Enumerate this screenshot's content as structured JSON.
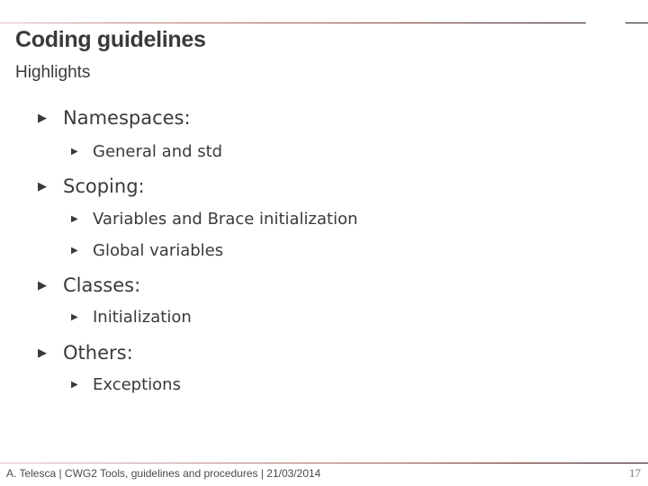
{
  "slide": {
    "title": "Coding guidelines",
    "subtitle": "Highlights"
  },
  "bullets": [
    {
      "label": "Namespaces:",
      "icon": "triangle-bullet-icon",
      "children": [
        {
          "label": "General and std",
          "icon": "triangle-bullet-icon"
        }
      ]
    },
    {
      "label": "Scoping:",
      "icon": "triangle-bullet-icon",
      "children": [
        {
          "label": "Variables and Brace initialization",
          "icon": "triangle-bullet-icon"
        },
        {
          "label": "Global variables",
          "icon": "triangle-bullet-icon"
        }
      ]
    },
    {
      "label": "Classes:",
      "icon": "triangle-bullet-icon",
      "children": [
        {
          "label": "Initialization",
          "icon": "triangle-bullet-icon"
        }
      ]
    },
    {
      "label": "Others:",
      "icon": "triangle-bullet-icon",
      "children": [
        {
          "label": "Exceptions",
          "icon": "triangle-bullet-icon"
        }
      ]
    }
  ],
  "glyphs": {
    "bullet": "▶"
  },
  "footer": {
    "text": "A. Telesca | CWG2 Tools, guidelines and procedures | 21/03/2014",
    "page_number": "17"
  },
  "colors": {
    "text": "#3a3a3a",
    "rule_dark": "#2a1a1a",
    "rule_accent": "#9a4a4a",
    "page_number": "#7a7a7a"
  }
}
